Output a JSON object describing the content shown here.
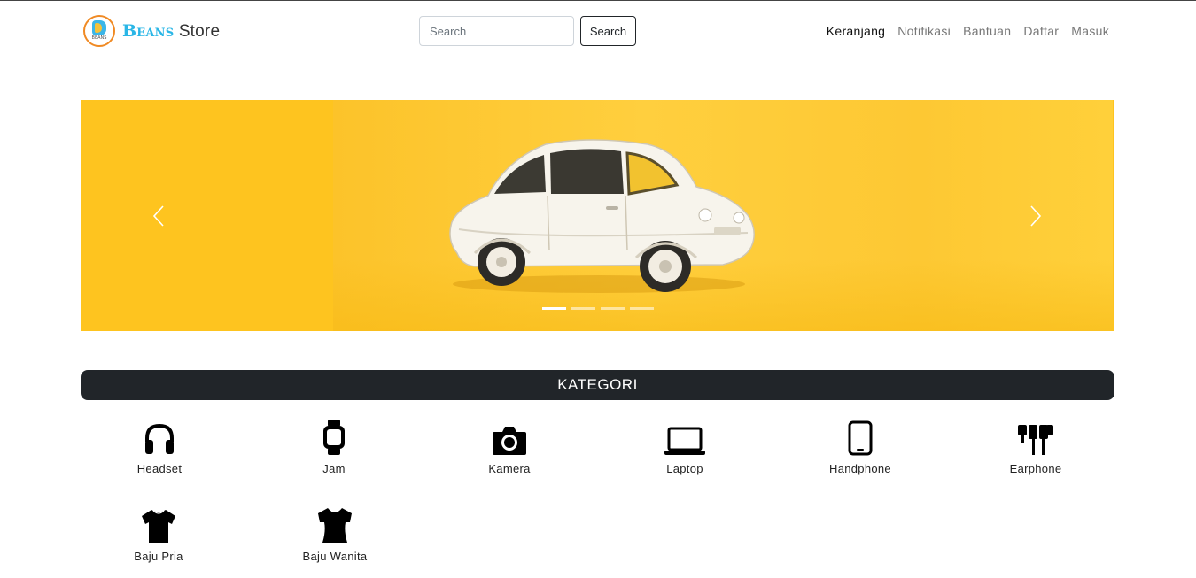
{
  "brand": {
    "name_bold": "Beans",
    "name_rest": "Store",
    "logo_text": "BEANS"
  },
  "search": {
    "placeholder": "Search",
    "button_label": "Search"
  },
  "nav": [
    {
      "label": "Keranjang",
      "active": true
    },
    {
      "label": "Notifikasi",
      "active": false
    },
    {
      "label": "Bantuan",
      "active": false
    },
    {
      "label": "Daftar",
      "active": false
    },
    {
      "label": "Masuk",
      "active": false
    }
  ],
  "carousel": {
    "slide_count": 4,
    "active_index": 0,
    "prev_icon": "chevron-left-icon",
    "next_icon": "chevron-right-icon",
    "background_color": "#fec41f"
  },
  "kategori": {
    "title": "KATEGORI",
    "items": [
      {
        "label": "Headset",
        "icon": "headset-icon"
      },
      {
        "label": "Jam",
        "icon": "watch-icon"
      },
      {
        "label": "Kamera",
        "icon": "camera-icon"
      },
      {
        "label": "Laptop",
        "icon": "laptop-icon"
      },
      {
        "label": "Handphone",
        "icon": "phone-icon"
      },
      {
        "label": "Earphone",
        "icon": "earphone-icon"
      },
      {
        "label": "Baju Pria",
        "icon": "tshirt-icon"
      },
      {
        "label": "Baju Wanita",
        "icon": "blouse-icon"
      }
    ]
  },
  "colors": {
    "accent_blue": "#2ab6e6",
    "dark": "#212529",
    "logo_orange": "#f08a24"
  }
}
